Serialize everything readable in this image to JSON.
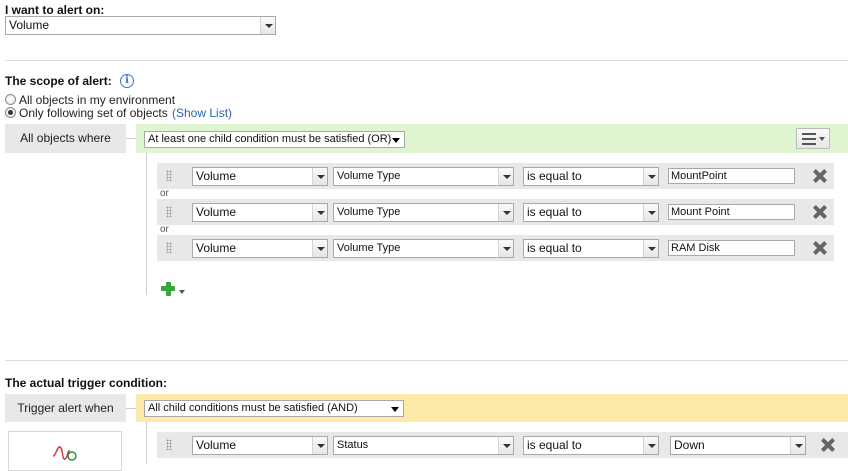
{
  "alert_on": {
    "heading": "I want to alert on:",
    "selected": "Volume"
  },
  "scope": {
    "heading": "The scope of alert:",
    "info_icon": "info-icon",
    "options": [
      {
        "label": "All objects in my environment",
        "checked": false
      },
      {
        "label": "Only following set of objects",
        "checked": true
      }
    ],
    "show_list": "(Show List)",
    "group_label": "All objects where",
    "group_operator": "At least one child condition must be satisfied (OR)",
    "menu_icon": "hamburger-menu-icon",
    "or_label": "or",
    "conditions": [
      {
        "entity": "Volume",
        "property": "Volume Type",
        "operator": "is equal to",
        "value": "MountPoint"
      },
      {
        "entity": "Volume",
        "property": "Volume Type",
        "operator": "is equal to",
        "value": "Mount Point"
      },
      {
        "entity": "Volume",
        "property": "Volume Type",
        "operator": "is equal to",
        "value": "RAM Disk"
      }
    ],
    "add_icon": "add-condition-plus-icon"
  },
  "trigger": {
    "heading": "The actual trigger condition:",
    "group_label": "Trigger alert when",
    "group_operator": "All child conditions must be satisfied (AND)",
    "condition": {
      "entity": "Volume",
      "property": "Status",
      "operator": "is equal to",
      "value": "Down"
    },
    "widget_icon": "waveform-icon"
  },
  "colors": {
    "scope_band": "#dff5d2",
    "trigger_band": "#fde9a8",
    "row_bg": "#e8e8e8",
    "link": "#2a62b8",
    "info": "#3a78c2",
    "add": "#3aa53a"
  }
}
